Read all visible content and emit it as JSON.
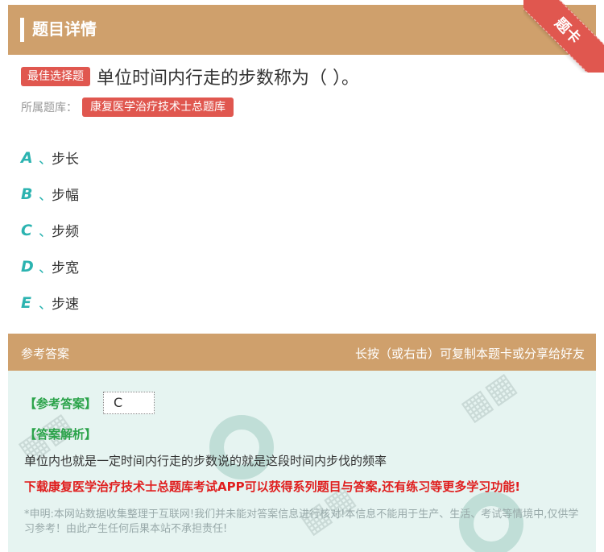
{
  "header": {
    "title": "题目详情",
    "ribbon": "题卡"
  },
  "question": {
    "type_tag": "最佳选择题",
    "text": "单位时间内行走的步数称为（ ）。",
    "bank_label": "所属题库：",
    "bank_name": "康复医学治疗技术士总题库"
  },
  "options": [
    {
      "letter": "A",
      "sep": "、",
      "text": "步长"
    },
    {
      "letter": "B",
      "sep": "、",
      "text": "步幅"
    },
    {
      "letter": "C",
      "sep": "、",
      "text": "步频"
    },
    {
      "letter": "D",
      "sep": "、",
      "text": "步宽"
    },
    {
      "letter": "E",
      "sep": "、",
      "text": "步速"
    }
  ],
  "answer_section": {
    "header_left": "参考答案",
    "header_right": "长按（或右击）可复制本题卡或分享给好友",
    "answer_label": "【参考答案】",
    "answer_value": "C",
    "analysis_label": "【答案解析】",
    "analysis_text": "单位内也就是一定时间内行走的步数说的就是这段时间内步伐的频率",
    "promo": "下载康复医学治疗技术士总题库考试APP可以获得系列题目与答案,还有练习等更多学习功能!",
    "disclaimer": "*申明:本网站数据收集整理于互联网!我们并未能对答案信息进行核对!本信息不能用于生产、生活、考试等情境中,仅供学习参考！由此产生任何后果本站不承担责任!"
  },
  "colors": {
    "header_bg": "#cfa06c",
    "accent_red": "#e0574f",
    "option_teal": "#2bb3b0",
    "answer_green": "#2ba34a",
    "promo_red": "#e01e1e",
    "answer_bg": "#e6f4f1"
  }
}
